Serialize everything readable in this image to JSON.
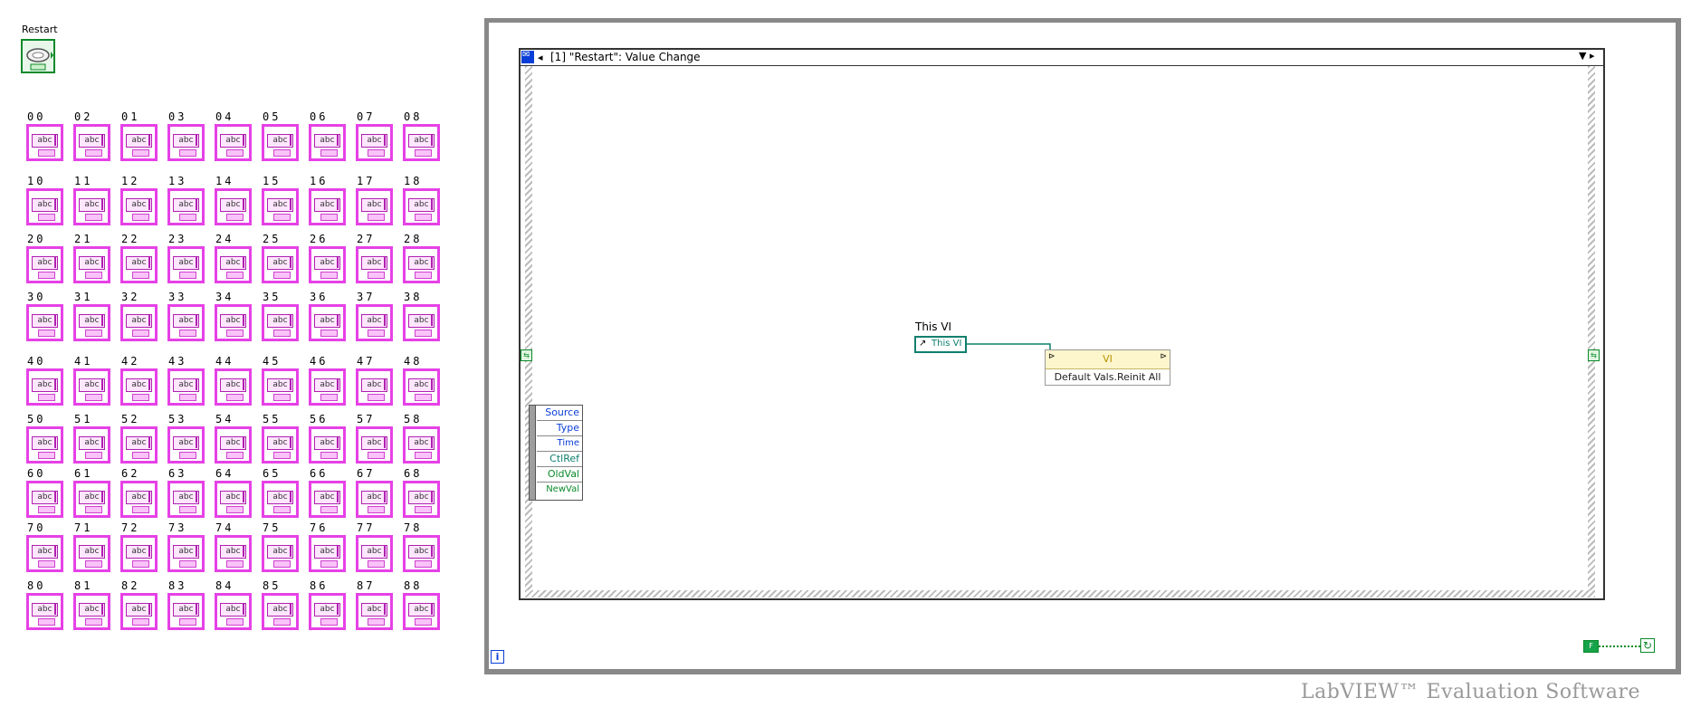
{
  "front_panel": {
    "restart_label": "Restart",
    "string_terminals": [
      [
        "00",
        "02",
        "01",
        "03",
        "04",
        "05",
        "06",
        "07",
        "08"
      ],
      [
        "10",
        "11",
        "12",
        "13",
        "14",
        "15",
        "16",
        "17",
        "18"
      ],
      [
        "20",
        "21",
        "22",
        "23",
        "24",
        "25",
        "26",
        "27",
        "28"
      ],
      [
        "30",
        "31",
        "32",
        "33",
        "34",
        "35",
        "36",
        "37",
        "38"
      ],
      [
        "40",
        "41",
        "42",
        "43",
        "44",
        "45",
        "46",
        "47",
        "48"
      ],
      [
        "50",
        "51",
        "52",
        "53",
        "54",
        "55",
        "56",
        "57",
        "58"
      ],
      [
        "60",
        "61",
        "62",
        "63",
        "64",
        "65",
        "66",
        "67",
        "68"
      ],
      [
        "70",
        "71",
        "72",
        "73",
        "74",
        "75",
        "76",
        "77",
        "78"
      ],
      [
        "80",
        "81",
        "82",
        "83",
        "84",
        "85",
        "86",
        "87",
        "88"
      ]
    ],
    "terminal_text": "abc",
    "terminal_icon": "string-terminal-icon",
    "terminal_color": "#e641e6"
  },
  "block_diagram": {
    "event_case_label": "[1] \"Restart\": Value Change",
    "event_data_fields": [
      "Source",
      "Type",
      "Time",
      "CtlRef",
      "OldVal",
      "NewVal"
    ],
    "this_vi_label": "This VI",
    "this_vi_text": "This VI",
    "invoke_class": "VI",
    "invoke_method": "Default Vals.Reinit All",
    "iteration_symbol": "i",
    "false_constant": "F"
  },
  "watermark": "LabVIEW™ Evaluation Software",
  "colors": {
    "boolean_green": "#0a8a2a",
    "reference_teal": "#0e7f6e",
    "loop_gray": "#888888",
    "blue_accent": "#0a3ed8"
  }
}
